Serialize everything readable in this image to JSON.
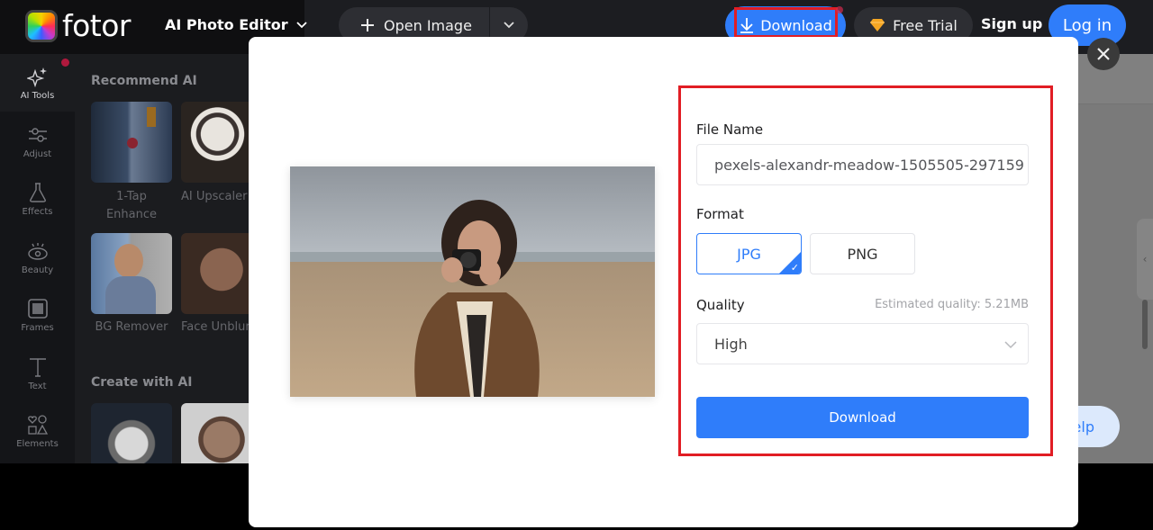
{
  "topbar": {
    "logo_text": "fotor",
    "product_menu": "AI Photo Editor",
    "open_image": "Open Image",
    "download": "Download",
    "free_trial": "Free Trial",
    "sign_up": "Sign up",
    "log_in": "Log in"
  },
  "sidebar": {
    "items": [
      {
        "label": "AI Tools",
        "icon": "sparkle-icon",
        "active": true
      },
      {
        "label": "Adjust",
        "icon": "sliders-icon"
      },
      {
        "label": "Effects",
        "icon": "flask-icon"
      },
      {
        "label": "Beauty",
        "icon": "eye-icon"
      },
      {
        "label": "Frames",
        "icon": "frame-icon"
      },
      {
        "label": "Text",
        "icon": "text-icon"
      },
      {
        "label": "Elements",
        "icon": "shapes-icon"
      }
    ]
  },
  "panel": {
    "recommend_title": "Recommend AI",
    "recommend_items": [
      {
        "label": "1-Tap Enhance"
      },
      {
        "label": "AI Upscaler"
      },
      {
        "label": "BG Remover"
      },
      {
        "label": "Face Unblur"
      }
    ],
    "create_title": "Create with AI"
  },
  "help": {
    "label": "Help"
  },
  "modal": {
    "file_name_label": "File Name",
    "file_name_value": "pexels-alexandr-meadow-1505505-297159",
    "format_label": "Format",
    "formats": [
      {
        "label": "JPG",
        "selected": true
      },
      {
        "label": "PNG",
        "selected": false
      }
    ],
    "quality_label": "Quality",
    "estimated": "Estimated quality: 5.21MB",
    "quality_value": "High",
    "download_button": "Download",
    "preview_alt": "Woman photographing with a camera on a beach"
  },
  "colors": {
    "accent": "#2f7dfa",
    "highlight": "#e11d24"
  }
}
